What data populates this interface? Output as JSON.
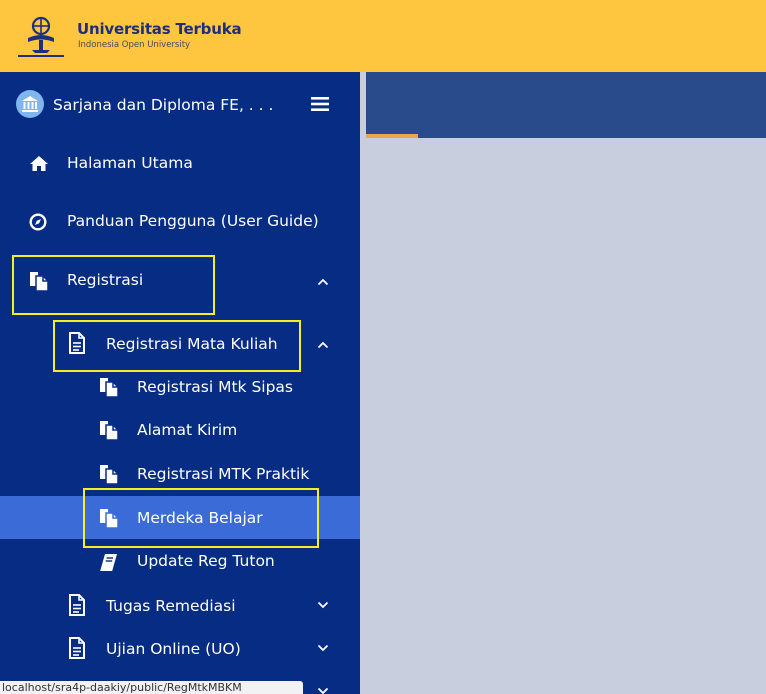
{
  "brand": {
    "name": "Universitas Terbuka",
    "tagline": "Indonesia Open University"
  },
  "sidebar": {
    "faculty_label": "Sarjana dan Diploma FE, . . .",
    "menu": {
      "home": "Halaman Utama",
      "user_guide": "Panduan Pengguna (User Guide)",
      "registrasi": "Registrasi",
      "registrasi_mata_kuliah": "Registrasi Mata Kuliah",
      "registrasi_mtk_sipas": "Registrasi Mtk Sipas",
      "alamat_kirim": "Alamat Kirim",
      "registrasi_mtk_praktik": "Registrasi MTK Praktik",
      "merdeka_belajar": "Merdeka Belajar",
      "update_reg_tuton": "Update Reg Tuton",
      "tugas_remediasi": "Tugas Remediasi",
      "ujian_online": "Ujian Online (UO)"
    }
  },
  "status_bar": {
    "url": "localhost/sra4p-daakiy/public/RegMtkMBKM"
  },
  "colors": {
    "header": "#fec53f",
    "sidebar": "#072c84",
    "active_item": "#3a6bd6",
    "topbar": "#2a4b8b",
    "topbar_accent": "#f1a152",
    "content": "#c8cedd",
    "highlight_box": "#f7ee1e"
  }
}
